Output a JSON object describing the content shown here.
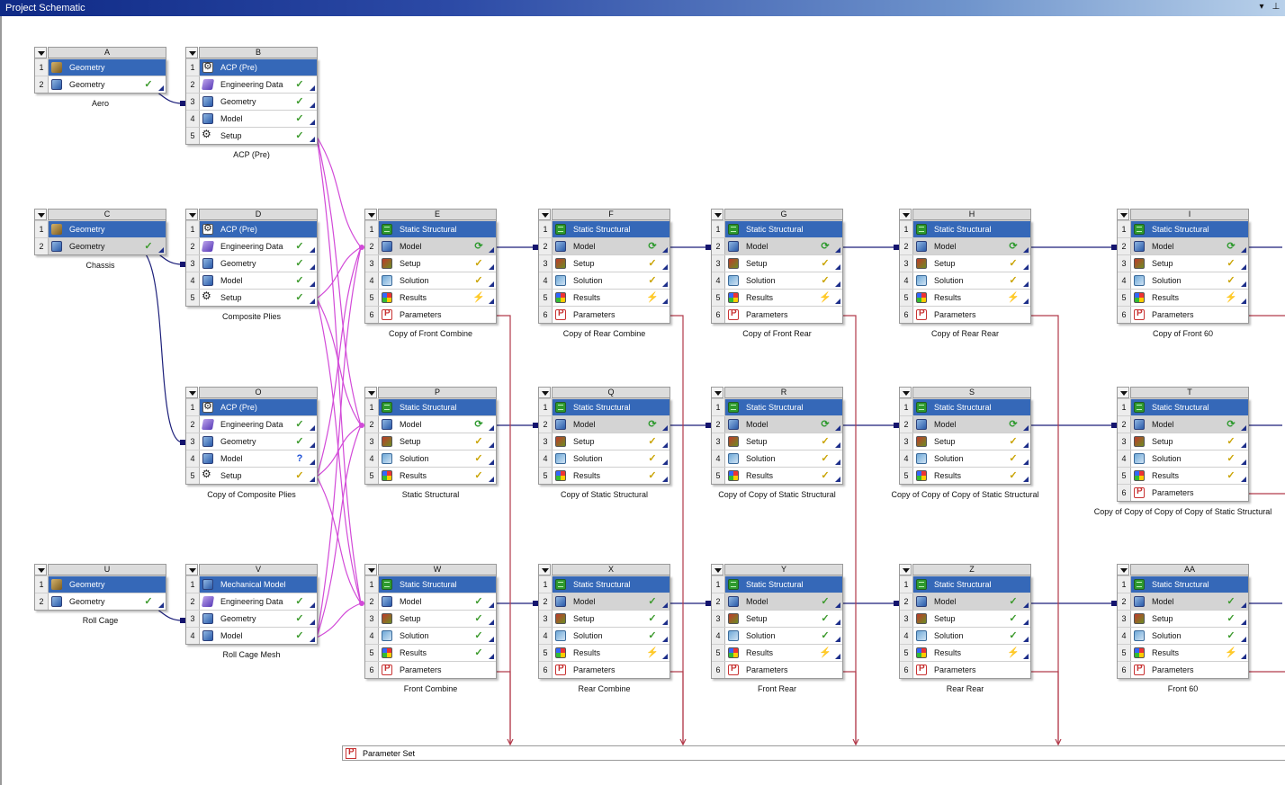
{
  "window": {
    "title": "Project Schematic",
    "dropdown_glyph": "▾",
    "pin_glyph": "⊥"
  },
  "parameter_set": {
    "label": "Parameter Set"
  },
  "systems": [
    {
      "id": "A",
      "caption": "Aero",
      "rows": [
        {
          "n": "1",
          "label": "Geometry",
          "icon": "geometry-icon",
          "status": "",
          "hl": true
        },
        {
          "n": "2",
          "label": "Geometry",
          "icon": "geometry-blue-icon",
          "status": "ok"
        }
      ]
    },
    {
      "id": "B",
      "caption": "ACP (Pre)",
      "rows": [
        {
          "n": "1",
          "label": "ACP (Pre)",
          "icon": "acp-icon",
          "status": "",
          "hl": true
        },
        {
          "n": "2",
          "label": "Engineering Data",
          "icon": "engineering-data-icon",
          "status": "ok"
        },
        {
          "n": "3",
          "label": "Geometry",
          "icon": "geometry-blue-icon",
          "status": "ok"
        },
        {
          "n": "4",
          "label": "Model",
          "icon": "model-icon",
          "status": "ok"
        },
        {
          "n": "5",
          "label": "Setup",
          "icon": "gear-icon",
          "status": "ok"
        }
      ]
    },
    {
      "id": "C",
      "caption": "Chassis",
      "rows": [
        {
          "n": "1",
          "label": "Geometry",
          "icon": "geometry-icon",
          "status": "",
          "hl": true
        },
        {
          "n": "2",
          "label": "Geometry",
          "icon": "geometry-blue-icon",
          "status": "ok",
          "sel": true
        }
      ]
    },
    {
      "id": "D",
      "caption": "Composite Plies",
      "rows": [
        {
          "n": "1",
          "label": "ACP (Pre)",
          "icon": "acp-icon",
          "status": "",
          "hl": true
        },
        {
          "n": "2",
          "label": "Engineering Data",
          "icon": "engineering-data-icon",
          "status": "ok"
        },
        {
          "n": "3",
          "label": "Geometry",
          "icon": "geometry-blue-icon",
          "status": "ok"
        },
        {
          "n": "4",
          "label": "Model",
          "icon": "model-icon",
          "status": "ok"
        },
        {
          "n": "5",
          "label": "Setup",
          "icon": "gear-icon",
          "status": "ok"
        }
      ]
    },
    {
      "id": "O",
      "caption": "Copy of Composite Plies",
      "rows": [
        {
          "n": "1",
          "label": "ACP (Pre)",
          "icon": "acp-icon",
          "status": "",
          "hl": true
        },
        {
          "n": "2",
          "label": "Engineering Data",
          "icon": "engineering-data-icon",
          "status": "ok"
        },
        {
          "n": "3",
          "label": "Geometry",
          "icon": "geometry-blue-icon",
          "status": "ok"
        },
        {
          "n": "4",
          "label": "Model",
          "icon": "model-icon",
          "status": "question"
        },
        {
          "n": "5",
          "label": "Setup",
          "icon": "gear-icon",
          "status": "update"
        }
      ]
    },
    {
      "id": "U",
      "caption": "Roll Cage",
      "rows": [
        {
          "n": "1",
          "label": "Geometry",
          "icon": "geometry-icon",
          "status": "",
          "hl": true
        },
        {
          "n": "2",
          "label": "Geometry",
          "icon": "geometry-blue-icon",
          "status": "ok"
        }
      ]
    },
    {
      "id": "V",
      "caption": "Roll Cage Mesh",
      "rows": [
        {
          "n": "1",
          "label": "Mechanical Model",
          "icon": "mechanical-model-icon",
          "status": "",
          "hl": true
        },
        {
          "n": "2",
          "label": "Engineering Data",
          "icon": "engineering-data-icon",
          "status": "ok"
        },
        {
          "n": "3",
          "label": "Geometry",
          "icon": "geometry-blue-icon",
          "status": "ok"
        },
        {
          "n": "4",
          "label": "Model",
          "icon": "model-icon",
          "status": "ok"
        }
      ]
    },
    {
      "id": "E",
      "caption": "Copy of Front Combine",
      "rows": [
        {
          "n": "1",
          "label": "Static Structural",
          "icon": "static-structural-icon",
          "status": "",
          "hl": true
        },
        {
          "n": "2",
          "label": "Model",
          "icon": "model-icon",
          "status": "refresh",
          "sel": true
        },
        {
          "n": "3",
          "label": "Setup",
          "icon": "setup-icon",
          "status": "update"
        },
        {
          "n": "4",
          "label": "Solution",
          "icon": "solution-icon",
          "status": "update"
        },
        {
          "n": "5",
          "label": "Results",
          "icon": "results-icon",
          "status": "bolt"
        },
        {
          "n": "6",
          "label": "Parameters",
          "icon": "parameters-icon",
          "status": ""
        }
      ]
    },
    {
      "id": "F",
      "caption": "Copy of Rear Combine",
      "rows": [
        {
          "n": "1",
          "label": "Static Structural",
          "icon": "static-structural-icon",
          "status": "",
          "hl": true
        },
        {
          "n": "2",
          "label": "Model",
          "icon": "model-icon",
          "status": "refresh",
          "sel": true
        },
        {
          "n": "3",
          "label": "Setup",
          "icon": "setup-icon",
          "status": "update"
        },
        {
          "n": "4",
          "label": "Solution",
          "icon": "solution-icon",
          "status": "update"
        },
        {
          "n": "5",
          "label": "Results",
          "icon": "results-icon",
          "status": "bolt"
        },
        {
          "n": "6",
          "label": "Parameters",
          "icon": "parameters-icon",
          "status": ""
        }
      ]
    },
    {
      "id": "G",
      "caption": "Copy of Front Rear",
      "rows": [
        {
          "n": "1",
          "label": "Static Structural",
          "icon": "static-structural-icon",
          "status": "",
          "hl": true
        },
        {
          "n": "2",
          "label": "Model",
          "icon": "model-icon",
          "status": "refresh",
          "sel": true
        },
        {
          "n": "3",
          "label": "Setup",
          "icon": "setup-icon",
          "status": "update"
        },
        {
          "n": "4",
          "label": "Solution",
          "icon": "solution-icon",
          "status": "update"
        },
        {
          "n": "5",
          "label": "Results",
          "icon": "results-icon",
          "status": "bolt"
        },
        {
          "n": "6",
          "label": "Parameters",
          "icon": "parameters-icon",
          "status": ""
        }
      ]
    },
    {
      "id": "H",
      "caption": "Copy of Rear Rear",
      "rows": [
        {
          "n": "1",
          "label": "Static Structural",
          "icon": "static-structural-icon",
          "status": "",
          "hl": true
        },
        {
          "n": "2",
          "label": "Model",
          "icon": "model-icon",
          "status": "refresh",
          "sel": true
        },
        {
          "n": "3",
          "label": "Setup",
          "icon": "setup-icon",
          "status": "update"
        },
        {
          "n": "4",
          "label": "Solution",
          "icon": "solution-icon",
          "status": "update"
        },
        {
          "n": "5",
          "label": "Results",
          "icon": "results-icon",
          "status": "bolt"
        },
        {
          "n": "6",
          "label": "Parameters",
          "icon": "parameters-icon",
          "status": ""
        }
      ]
    },
    {
      "id": "I",
      "caption": "Copy of Front 60",
      "rows": [
        {
          "n": "1",
          "label": "Static Structural",
          "icon": "static-structural-icon",
          "status": "",
          "hl": true
        },
        {
          "n": "2",
          "label": "Model",
          "icon": "model-icon",
          "status": "refresh",
          "sel": true
        },
        {
          "n": "3",
          "label": "Setup",
          "icon": "setup-icon",
          "status": "update"
        },
        {
          "n": "4",
          "label": "Solution",
          "icon": "solution-icon",
          "status": "update"
        },
        {
          "n": "5",
          "label": "Results",
          "icon": "results-icon",
          "status": "bolt"
        },
        {
          "n": "6",
          "label": "Parameters",
          "icon": "parameters-icon",
          "status": ""
        }
      ]
    },
    {
      "id": "P",
      "caption": "Static Structural",
      "rows": [
        {
          "n": "1",
          "label": "Static Structural",
          "icon": "static-structural-icon",
          "status": "",
          "hl": true
        },
        {
          "n": "2",
          "label": "Model",
          "icon": "model-icon",
          "status": "refresh"
        },
        {
          "n": "3",
          "label": "Setup",
          "icon": "setup-icon",
          "status": "update"
        },
        {
          "n": "4",
          "label": "Solution",
          "icon": "solution-icon",
          "status": "update"
        },
        {
          "n": "5",
          "label": "Results",
          "icon": "results-icon",
          "status": "update"
        }
      ]
    },
    {
      "id": "Q",
      "caption": "Copy of Static Structural",
      "rows": [
        {
          "n": "1",
          "label": "Static Structural",
          "icon": "static-structural-icon",
          "status": "",
          "hl": true
        },
        {
          "n": "2",
          "label": "Model",
          "icon": "model-icon",
          "status": "refresh",
          "sel": true
        },
        {
          "n": "3",
          "label": "Setup",
          "icon": "setup-icon",
          "status": "update"
        },
        {
          "n": "4",
          "label": "Solution",
          "icon": "solution-icon",
          "status": "update"
        },
        {
          "n": "5",
          "label": "Results",
          "icon": "results-icon",
          "status": "update"
        }
      ]
    },
    {
      "id": "R",
      "caption": "Copy of Copy of Static Structural",
      "rows": [
        {
          "n": "1",
          "label": "Static Structural",
          "icon": "static-structural-icon",
          "status": "",
          "hl": true
        },
        {
          "n": "2",
          "label": "Model",
          "icon": "model-icon",
          "status": "refresh",
          "sel": true
        },
        {
          "n": "3",
          "label": "Setup",
          "icon": "setup-icon",
          "status": "update"
        },
        {
          "n": "4",
          "label": "Solution",
          "icon": "solution-icon",
          "status": "update"
        },
        {
          "n": "5",
          "label": "Results",
          "icon": "results-icon",
          "status": "update"
        }
      ]
    },
    {
      "id": "S",
      "caption": "Copy of Copy of Copy of Static Structural",
      "rows": [
        {
          "n": "1",
          "label": "Static Structural",
          "icon": "static-structural-icon",
          "status": "",
          "hl": true
        },
        {
          "n": "2",
          "label": "Model",
          "icon": "model-icon",
          "status": "refresh",
          "sel": true
        },
        {
          "n": "3",
          "label": "Setup",
          "icon": "setup-icon",
          "status": "update"
        },
        {
          "n": "4",
          "label": "Solution",
          "icon": "solution-icon",
          "status": "update"
        },
        {
          "n": "5",
          "label": "Results",
          "icon": "results-icon",
          "status": "update"
        }
      ]
    },
    {
      "id": "T",
      "caption": "Copy of Copy of Copy of Copy of Static Structural",
      "rows": [
        {
          "n": "1",
          "label": "Static Structural",
          "icon": "static-structural-icon",
          "status": "",
          "hl": true
        },
        {
          "n": "2",
          "label": "Model",
          "icon": "model-icon",
          "status": "refresh",
          "sel": true
        },
        {
          "n": "3",
          "label": "Setup",
          "icon": "setup-icon",
          "status": "update"
        },
        {
          "n": "4",
          "label": "Solution",
          "icon": "solution-icon",
          "status": "update"
        },
        {
          "n": "5",
          "label": "Results",
          "icon": "results-icon",
          "status": "update"
        },
        {
          "n": "6",
          "label": "Parameters",
          "icon": "parameters-icon",
          "status": ""
        }
      ]
    },
    {
      "id": "W",
      "caption": "Front Combine",
      "rows": [
        {
          "n": "1",
          "label": "Static Structural",
          "icon": "static-structural-icon",
          "status": "",
          "hl": true
        },
        {
          "n": "2",
          "label": "Model",
          "icon": "model-icon",
          "status": "ok"
        },
        {
          "n": "3",
          "label": "Setup",
          "icon": "setup-icon",
          "status": "ok"
        },
        {
          "n": "4",
          "label": "Solution",
          "icon": "solution-icon",
          "status": "ok"
        },
        {
          "n": "5",
          "label": "Results",
          "icon": "results-icon",
          "status": "ok"
        },
        {
          "n": "6",
          "label": "Parameters",
          "icon": "parameters-icon",
          "status": ""
        }
      ]
    },
    {
      "id": "X",
      "caption": "Rear Combine",
      "rows": [
        {
          "n": "1",
          "label": "Static Structural",
          "icon": "static-structural-icon",
          "status": "",
          "hl": true
        },
        {
          "n": "2",
          "label": "Model",
          "icon": "model-icon",
          "status": "ok",
          "sel": true
        },
        {
          "n": "3",
          "label": "Setup",
          "icon": "setup-icon",
          "status": "ok"
        },
        {
          "n": "4",
          "label": "Solution",
          "icon": "solution-icon",
          "status": "ok"
        },
        {
          "n": "5",
          "label": "Results",
          "icon": "results-icon",
          "status": "bolt"
        },
        {
          "n": "6",
          "label": "Parameters",
          "icon": "parameters-icon",
          "status": ""
        }
      ]
    },
    {
      "id": "Y",
      "caption": "Front Rear",
      "rows": [
        {
          "n": "1",
          "label": "Static Structural",
          "icon": "static-structural-icon",
          "status": "",
          "hl": true
        },
        {
          "n": "2",
          "label": "Model",
          "icon": "model-icon",
          "status": "ok",
          "sel": true
        },
        {
          "n": "3",
          "label": "Setup",
          "icon": "setup-icon",
          "status": "ok"
        },
        {
          "n": "4",
          "label": "Solution",
          "icon": "solution-icon",
          "status": "ok"
        },
        {
          "n": "5",
          "label": "Results",
          "icon": "results-icon",
          "status": "bolt"
        },
        {
          "n": "6",
          "label": "Parameters",
          "icon": "parameters-icon",
          "status": ""
        }
      ]
    },
    {
      "id": "Z",
      "caption": "Rear Rear",
      "rows": [
        {
          "n": "1",
          "label": "Static Structural",
          "icon": "static-structural-icon",
          "status": "",
          "hl": true
        },
        {
          "n": "2",
          "label": "Model",
          "icon": "model-icon",
          "status": "ok",
          "sel": true
        },
        {
          "n": "3",
          "label": "Setup",
          "icon": "setup-icon",
          "status": "ok"
        },
        {
          "n": "4",
          "label": "Solution",
          "icon": "solution-icon",
          "status": "ok"
        },
        {
          "n": "5",
          "label": "Results",
          "icon": "results-icon",
          "status": "bolt"
        },
        {
          "n": "6",
          "label": "Parameters",
          "icon": "parameters-icon",
          "status": ""
        }
      ]
    },
    {
      "id": "AA",
      "caption": "Front 60",
      "rows": [
        {
          "n": "1",
          "label": "Static Structural",
          "icon": "static-structural-icon",
          "status": "",
          "hl": true
        },
        {
          "n": "2",
          "label": "Model",
          "icon": "model-icon",
          "status": "ok",
          "sel": true
        },
        {
          "n": "3",
          "label": "Setup",
          "icon": "setup-icon",
          "status": "ok"
        },
        {
          "n": "4",
          "label": "Solution",
          "icon": "solution-icon",
          "status": "ok"
        },
        {
          "n": "5",
          "label": "Results",
          "icon": "results-icon",
          "status": "bolt"
        },
        {
          "n": "6",
          "label": "Parameters",
          "icon": "parameters-icon",
          "status": ""
        }
      ]
    }
  ],
  "status_glyphs": {
    "ok": "✓",
    "refresh": "⟳",
    "update": "✓",
    "question": "?",
    "bolt": "⚡"
  },
  "colors": {
    "header_highlight": "#3568b8",
    "link_dark": "#1c1f7a",
    "link_param": "#b23a4a",
    "link_magenta": "#d24ad8"
  }
}
